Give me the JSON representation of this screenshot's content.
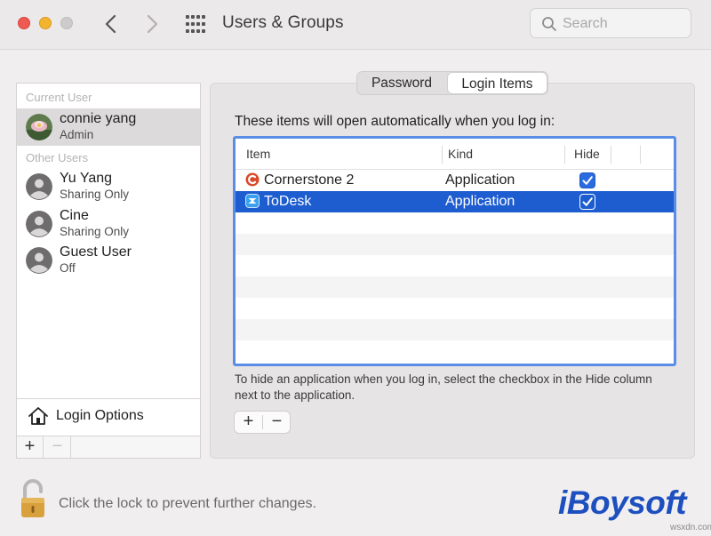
{
  "window": {
    "title": "Users & Groups",
    "search_placeholder": "Search"
  },
  "sidebar": {
    "current_user_label": "Current User",
    "current_user": {
      "name": "connie yang",
      "role": "Admin"
    },
    "other_users_label": "Other Users",
    "other_users": [
      {
        "name": "Yu Yang",
        "role": "Sharing Only"
      },
      {
        "name": "Cine",
        "role": "Sharing Only"
      },
      {
        "name": "Guest User",
        "role": "Off"
      }
    ],
    "login_options_label": "Login Options",
    "add_label": "+",
    "remove_label": "−"
  },
  "tabs": [
    {
      "label": "Password",
      "selected": false
    },
    {
      "label": "Login Items",
      "selected": true
    }
  ],
  "main": {
    "intro": "These items will open automatically when you log in:",
    "columns": {
      "item": "Item",
      "kind": "Kind",
      "hide": "Hide"
    },
    "rows": [
      {
        "item": "Cornerstone 2",
        "kind": "Application",
        "hide": true,
        "selected": false,
        "icon": "cornerstone-app-icon"
      },
      {
        "item": "ToDesk",
        "kind": "Application",
        "hide": true,
        "selected": true,
        "icon": "todesk-app-icon"
      }
    ],
    "hint": "To hide an application when you log in, select the checkbox in the Hide column next to the application.",
    "add_label": "+",
    "remove_label": "−"
  },
  "footer": {
    "lock_text": "Click the lock to prevent further changes.",
    "brand": "iBoysoft",
    "watermark": "wsxdn.com"
  },
  "colors": {
    "selection": "#1e5dd0",
    "table_border": "#5a8ee6",
    "checkbox": "#2b6be0",
    "brand": "#1d4fbf"
  }
}
